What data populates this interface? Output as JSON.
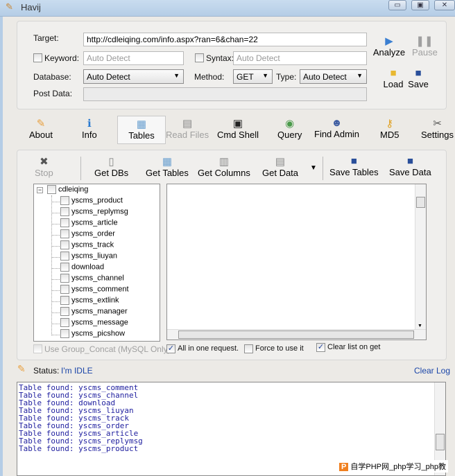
{
  "window": {
    "title": "Havij",
    "minimize": "▭",
    "maximize": "▣",
    "close": "✕"
  },
  "form": {
    "target_label": "Target:",
    "target_value": "http://cdleiqing.com/info.aspx?ran=6&chan=22",
    "keyword_label": "Keyword:",
    "keyword_placeholder": "Auto Detect",
    "keyword_checked": false,
    "syntax_label": "Syntax:",
    "syntax_placeholder": "Auto Detect",
    "syntax_checked": false,
    "database_label": "Database:",
    "database_value": "Auto Detect",
    "method_label": "Method:",
    "method_value": "GET",
    "type_label": "Type:",
    "type_value": "Auto Detect",
    "postdata_label": "Post Data:",
    "postdata_value": ""
  },
  "actions": {
    "analyze": "Analyze",
    "pause": "Pause",
    "load": "Load",
    "save": "Save"
  },
  "tabs": [
    {
      "label": "About",
      "icon": "carrot-icon"
    },
    {
      "label": "Info",
      "icon": "info-icon"
    },
    {
      "label": "Tables",
      "icon": "table-icon",
      "selected": true
    },
    {
      "label": "Read Files",
      "icon": "file-icon",
      "disabled": true
    },
    {
      "label": "Cmd Shell",
      "icon": "terminal-icon"
    },
    {
      "label": "Query",
      "icon": "query-icon"
    },
    {
      "label": "Find Admin",
      "icon": "user-icon"
    },
    {
      "label": "MD5",
      "icon": "key-icon"
    },
    {
      "label": "Settings",
      "icon": "tools-icon"
    }
  ],
  "toolbar": {
    "stop": "Stop",
    "get_dbs": "Get DBs",
    "get_tables": "Get Tables",
    "get_columns": "Get Columns",
    "get_data": "Get Data",
    "save_tables": "Save Tables",
    "save_data": "Save Data"
  },
  "tree": {
    "root": "cdleiqing",
    "items": [
      "yscms_product",
      "yscms_replymsg",
      "yscms_article",
      "yscms_order",
      "yscms_track",
      "yscms_liuyan",
      "download",
      "yscms_channel",
      "yscms_comment",
      "yscms_extlink",
      "yscms_manager",
      "yscms_message",
      "yscms_picshow"
    ]
  },
  "options": {
    "group_concat": "Use Group_Concat (MySQL Only)",
    "all_in_one": "All in one request.",
    "force": "Force to use it",
    "clear_list": "Clear list on get"
  },
  "status": {
    "label": "Status:",
    "value": "I'm IDLE",
    "clear_log": "Clear Log"
  },
  "log": [
    "Table found: yscms_comment",
    "Table found: yscms_channel",
    "Table found: download",
    "Table found: yscms_liuyan",
    "Table found: yscms_track",
    "Table found: yscms_order",
    "Table found: yscms_article",
    "Table found: yscms_replymsg",
    "Table found: yscms_product"
  ],
  "watermark": "自学PHP网_php学习_php教"
}
